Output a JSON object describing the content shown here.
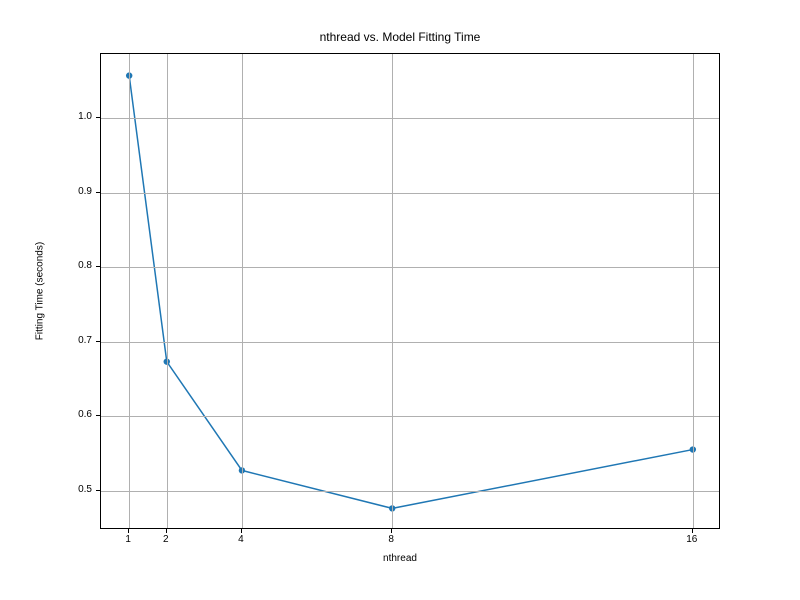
{
  "chart_data": {
    "type": "line",
    "title": "nthread vs. Model Fitting Time",
    "xlabel": "nthread",
    "ylabel": "Fitting Time (seconds)",
    "x": [
      1,
      2,
      4,
      8,
      16
    ],
    "values": [
      1.057,
      0.673,
      0.527,
      0.476,
      0.555
    ],
    "x_ticks": [
      1,
      2,
      4,
      8,
      16
    ],
    "y_ticks": [
      0.5,
      0.6,
      0.7,
      0.8,
      0.9,
      1.0
    ],
    "xlim": [
      0.25,
      16.75
    ],
    "ylim": [
      0.447,
      1.086
    ],
    "marker_color": "#1f77b4",
    "line_color": "#1f77b4"
  }
}
